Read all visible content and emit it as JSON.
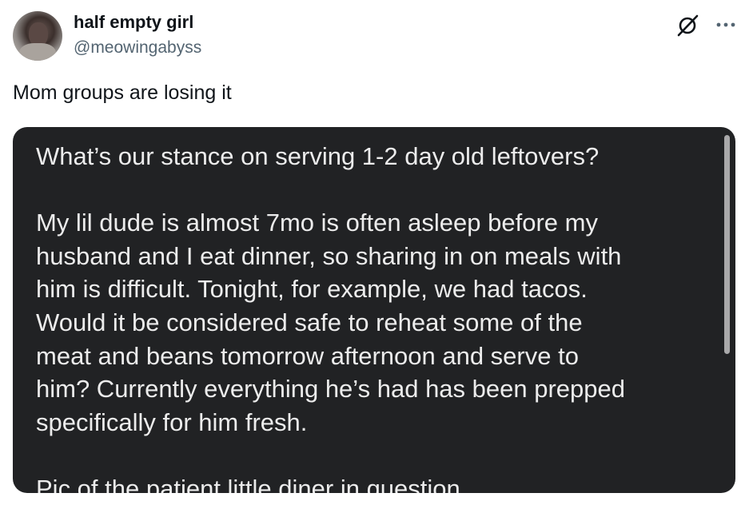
{
  "author": {
    "display_name": "half empty girl",
    "handle": "@meowingabyss"
  },
  "tweet": {
    "text": "Mom groups are losing it"
  },
  "media": {
    "lines": [
      "What’s our stance on serving 1-2 day old leftovers?",
      "",
      "My lil dude is almost 7mo is often asleep before my",
      "husband and I eat dinner, so sharing in on meals with",
      "him is difficult. Tonight, for example, we had tacos.",
      "Would it be considered safe to reheat some of the",
      "meat and beans tomorrow afternoon and serve to",
      "him? Currently everything he’s had has been prepped",
      "specifically for him fresh.",
      "",
      "Pic of the patient little diner in question."
    ]
  },
  "icons": {
    "grok": "grok-icon",
    "more": "more-dots-icon",
    "avatar": "avatar-photo"
  },
  "colors": {
    "text_primary": "#0f1419",
    "text_secondary": "#536471",
    "media_background": "#212224",
    "media_text": "#ececec"
  }
}
